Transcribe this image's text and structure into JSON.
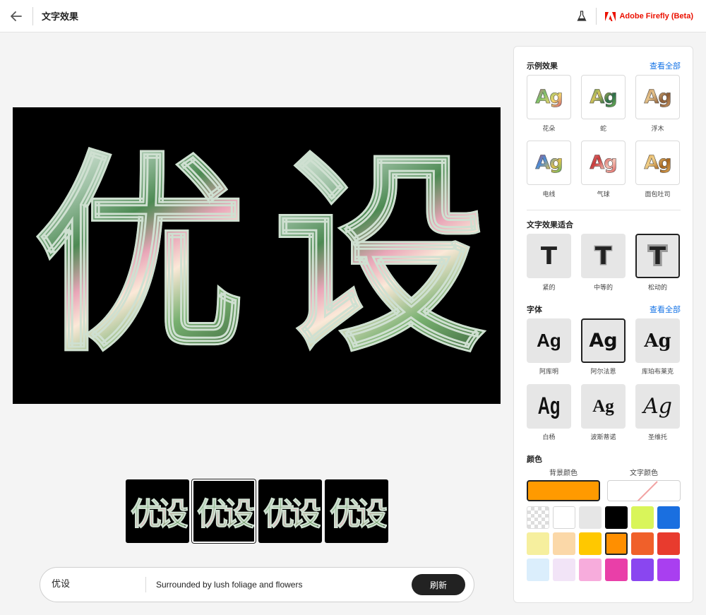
{
  "header": {
    "title": "文字效果",
    "brand": "Adobe Firefly (Beta)"
  },
  "canvas": {
    "char1": "优",
    "char2": "设"
  },
  "thumbnails": [
    {
      "text": "优设"
    },
    {
      "text": "优设"
    },
    {
      "text": "优设"
    },
    {
      "text": "优设"
    }
  ],
  "prompt": {
    "word": "优设",
    "description": "Surrounded by lush foliage and flowers",
    "refresh": "刷新"
  },
  "panel": {
    "examples": {
      "title": "示例效果",
      "see_all": "查看全部",
      "items": [
        {
          "label": "花朵",
          "glyph": "Ag"
        },
        {
          "label": "蛇",
          "glyph": "Ag"
        },
        {
          "label": "浮木",
          "glyph": "Ag"
        },
        {
          "label": "电线",
          "glyph": "Ag"
        },
        {
          "label": "气球",
          "glyph": "Ag"
        },
        {
          "label": "面包吐司",
          "glyph": "Ag"
        }
      ]
    },
    "fit": {
      "title": "文字效果适合",
      "items": [
        {
          "label": "紧的",
          "glyph": "T"
        },
        {
          "label": "中等的",
          "glyph": "T"
        },
        {
          "label": "松动的",
          "glyph": "T"
        }
      ]
    },
    "fonts": {
      "title": "字体",
      "see_all": "查看全部",
      "items": [
        {
          "label": "阿库明",
          "glyph": "Ag"
        },
        {
          "label": "阿尔法恩",
          "glyph": "Ag"
        },
        {
          "label": "库珀布莱克",
          "glyph": "Ag"
        },
        {
          "label": "白杨",
          "glyph": "Ag"
        },
        {
          "label": "波斯蒂诺",
          "glyph": "Ag"
        },
        {
          "label": "圣维托",
          "glyph": "Ag"
        }
      ]
    },
    "color": {
      "title": "颜色",
      "background_label": "背景颜色",
      "text_label": "文字颜色",
      "background_value": "#ff9a00",
      "swatches": [
        "transparent",
        "#ffffff",
        "#e6e6e6",
        "#000000",
        "#d9f55a",
        "#1a6fe0",
        "#f6ef9e",
        "#fbd8a8",
        "#ffc800",
        "#ff8f00",
        "#f0602a",
        "#e83b2e",
        "#dbeefc",
        "#f2e4f7",
        "#f7acdc",
        "#e93fa8",
        "#8a46f0",
        "#a93ff0"
      ],
      "selected_swatch": "#ff8f00"
    }
  }
}
